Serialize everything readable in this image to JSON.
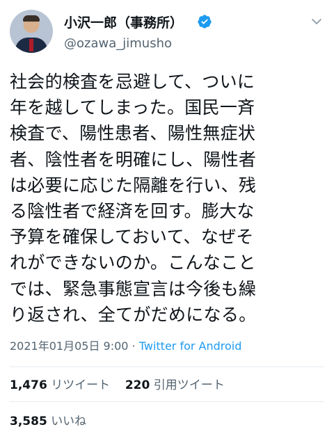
{
  "author": {
    "name": "小沢一郎（事務所）",
    "handle": "@ozawa_jimusho",
    "verified_icon": "verified-badge-icon",
    "verified_color": "#1d9bf0"
  },
  "tweet": {
    "text": "社会的検査を忌避して、ついに\n年を越してしまった。国民一斉\n検査で、陽性患者、陽性無症状\n者、陰性者を明確にし、陽性者\nは必要に応じた隔離を行い、残\nる陰性者で経済を回す。膨大な\n予算を確保しておいて、なぜそ\nれができないのか。こんなこと\nでは、緊急事態宣言は今後も繰\nり返され、全てがだめになる。",
    "timestamp": "2021年01月05日 9:00",
    "separator": "·",
    "source": "Twitter for Android"
  },
  "stats": {
    "retweets_count": "1,476",
    "retweets_label": "リツイート",
    "quotes_count": "220",
    "quotes_label": "引用ツイート",
    "likes_count": "3,585",
    "likes_label": "いいね"
  },
  "icons": {
    "menu": "chevron-down-icon"
  }
}
